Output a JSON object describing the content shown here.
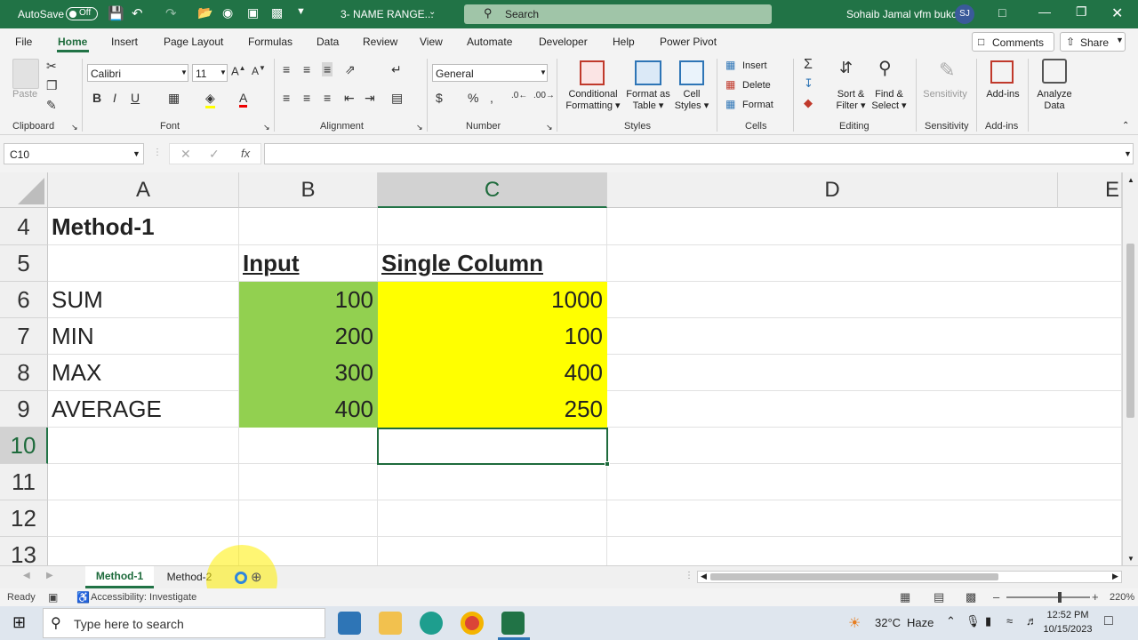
{
  "titlebar": {
    "autosave": "AutoSave",
    "autosave_state": "Off",
    "filename": "3- NAME RANGE...",
    "search": "Search",
    "user": "Sohaib Jamal vfm bukc",
    "initials": "SJ"
  },
  "tabs": [
    "File",
    "Home",
    "Insert",
    "Page Layout",
    "Formulas",
    "Data",
    "Review",
    "View",
    "Automate",
    "Developer",
    "Help",
    "Power Pivot"
  ],
  "active_tab": "Home",
  "comments": "Comments",
  "share": "Share",
  "ribbon": {
    "clipboard": {
      "paste": "Paste",
      "label": "Clipboard"
    },
    "font": {
      "name": "Calibri",
      "size": "11",
      "label": "Font"
    },
    "alignment": {
      "label": "Alignment"
    },
    "number": {
      "format": "General",
      "label": "Number"
    },
    "styles": {
      "conditional": [
        "Conditional",
        "Formatting"
      ],
      "format_table": [
        "Format as",
        "Table"
      ],
      "cell_styles": [
        "Cell",
        "Styles"
      ],
      "label": "Styles"
    },
    "cells": {
      "insert": "Insert",
      "delete": "Delete",
      "format": "Format",
      "label": "Cells"
    },
    "editing": {
      "sort": [
        "Sort &",
        "Filter"
      ],
      "find": [
        "Find &",
        "Select"
      ],
      "label": "Editing"
    },
    "sensitivity": {
      "button": "Sensitivity",
      "label": "Sensitivity"
    },
    "addins": {
      "button": "Add-ins",
      "label": "Add-ins"
    },
    "analyze": {
      "button": [
        "Analyze",
        "Data"
      ]
    }
  },
  "namebox": "C10",
  "formula": "",
  "columns": [
    "A",
    "B",
    "C",
    "D",
    "E"
  ],
  "rows": [
    "4",
    "5",
    "6",
    "7",
    "8",
    "9",
    "10",
    "11",
    "12",
    "13"
  ],
  "cells": {
    "A4": "Method-1",
    "B5": "Input",
    "C5": "Single Column",
    "A6": "SUM",
    "B6": "100",
    "C6": "1000",
    "A7": "MIN",
    "B7": "200",
    "C7": "100",
    "A8": "MAX",
    "B8": "300",
    "C8": "400",
    "A9": "AVERAGE",
    "B9": "400",
    "C9": "250"
  },
  "colors": {
    "green_fill": "#92d050",
    "yellow_fill": "#ffff00",
    "excel_green": "#217346"
  },
  "sheets": [
    "Method-1",
    "Method-2"
  ],
  "active_sheet": "Method-1",
  "status": {
    "ready": "Ready",
    "accessibility": "Accessibility: Investigate",
    "zoom": "220%"
  },
  "taskbar": {
    "search": "Type here to search",
    "weather": "32°C",
    "condition": "Haze",
    "time": "12:52 PM",
    "date": "10/15/2023"
  }
}
